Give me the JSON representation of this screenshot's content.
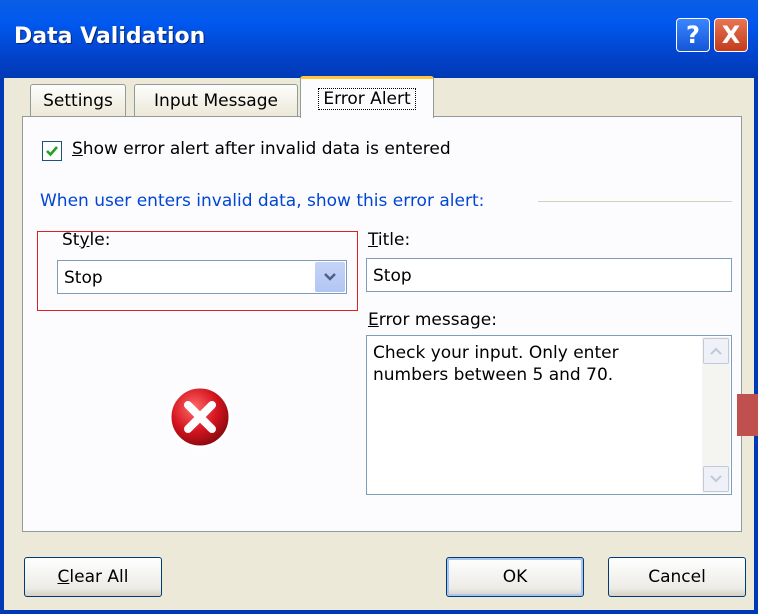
{
  "window": {
    "title": "Data Validation",
    "help_glyph": "?",
    "close_glyph": "X"
  },
  "tabs": [
    {
      "label": "Settings"
    },
    {
      "label": "Input Message"
    },
    {
      "label": "Error Alert",
      "selected": true
    }
  ],
  "show_error_alert": {
    "checked": true,
    "label_prefix": "S",
    "label_rest": "how error alert after invalid data is entered"
  },
  "group_label": "When user enters invalid data, show this error alert:",
  "style": {
    "label_prefix": "St",
    "label_mnemonic": "y",
    "label_rest": "le:",
    "value": "Stop"
  },
  "title": {
    "label_mnemonic": "T",
    "label_rest": "itle:",
    "value": "Stop"
  },
  "error_message": {
    "label_mnemonic": "E",
    "label_rest": "rror message:",
    "value": "Check your input. Only enter numbers between 5 and 70."
  },
  "buttons": {
    "clear_mnemonic": "C",
    "clear_rest": "lear All",
    "ok": "OK",
    "cancel": "Cancel"
  },
  "colors": {
    "highlight_box": "#e02020",
    "group_label": "#0046d5",
    "stop_icon": "#c8102e"
  }
}
